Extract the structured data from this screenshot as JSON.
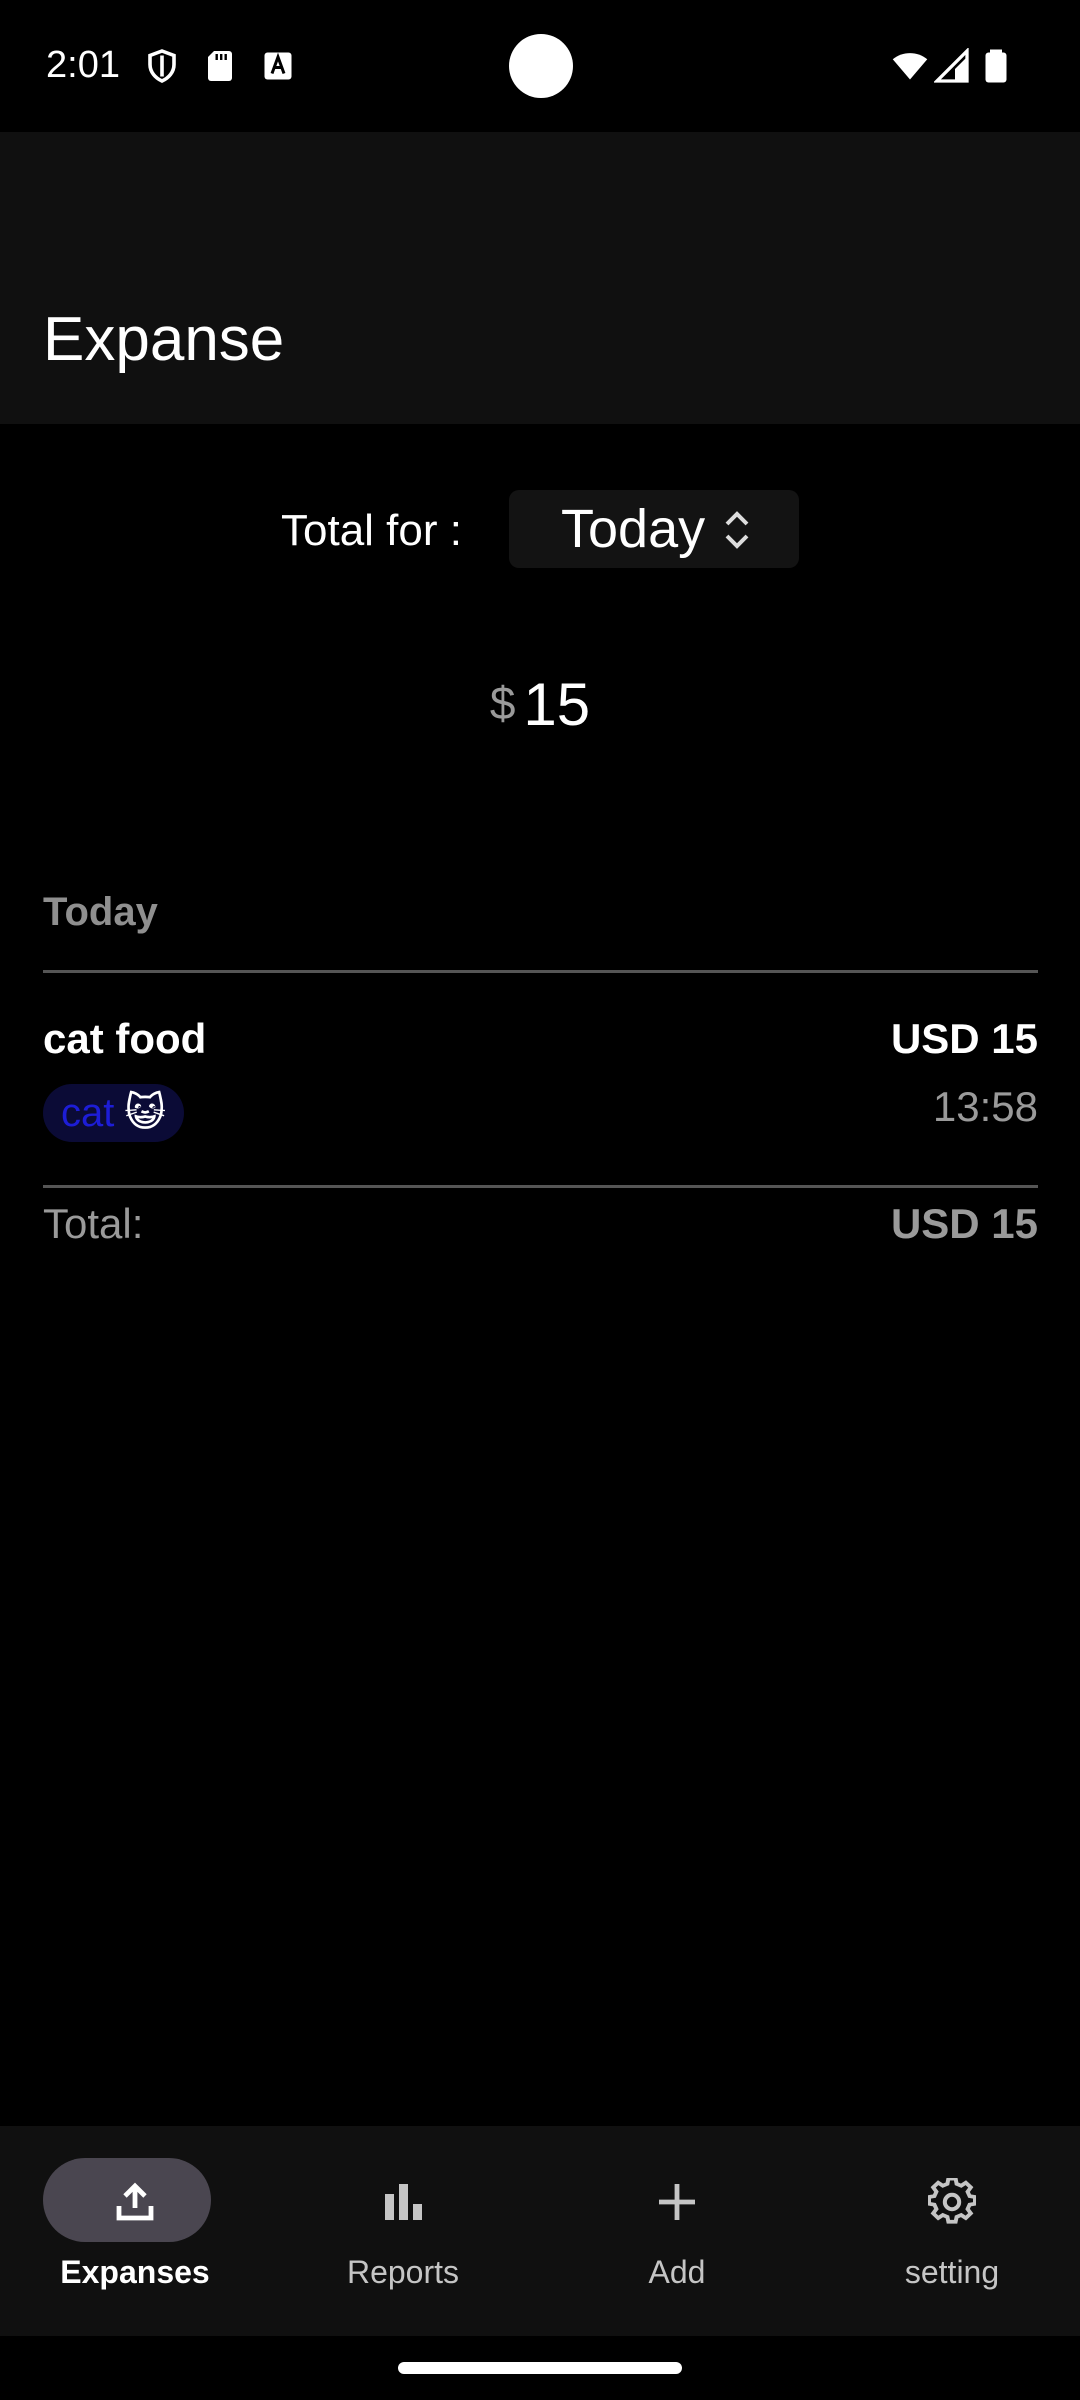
{
  "status_bar": {
    "time": "2:01",
    "left_icons": [
      "shield-icon",
      "sd-card-icon",
      "font-icon"
    ],
    "right_icons": [
      "wifi-icon",
      "signal-icon",
      "battery-icon"
    ]
  },
  "app_bar": {
    "title": "Expanse"
  },
  "summary": {
    "total_for_label": "Total for :",
    "period_value": "Today",
    "currency_symbol": "$",
    "amount": "15"
  },
  "list": {
    "section_header": "Today",
    "items": [
      {
        "title": "cat food",
        "amount": "USD 15",
        "time": "13:58",
        "tag": "cat",
        "tag_emoji": "😺"
      }
    ],
    "total_label": "Total:",
    "total_value": "USD 15"
  },
  "bottom_nav": {
    "items": [
      {
        "label": "Expanses",
        "icon": "upload-icon",
        "active": true
      },
      {
        "label": "Reports",
        "icon": "bar-chart-icon",
        "active": false
      },
      {
        "label": "Add",
        "icon": "plus-icon",
        "active": false
      },
      {
        "label": "setting",
        "icon": "gear-icon",
        "active": false
      }
    ]
  },
  "colors": {
    "background": "#000000",
    "app_bar": "#101010",
    "active_pill": "#4a4650",
    "tag_chip_bg": "#0b0b36",
    "tag_text": "#1d1dd6",
    "muted_text": "#9a9a9a"
  }
}
